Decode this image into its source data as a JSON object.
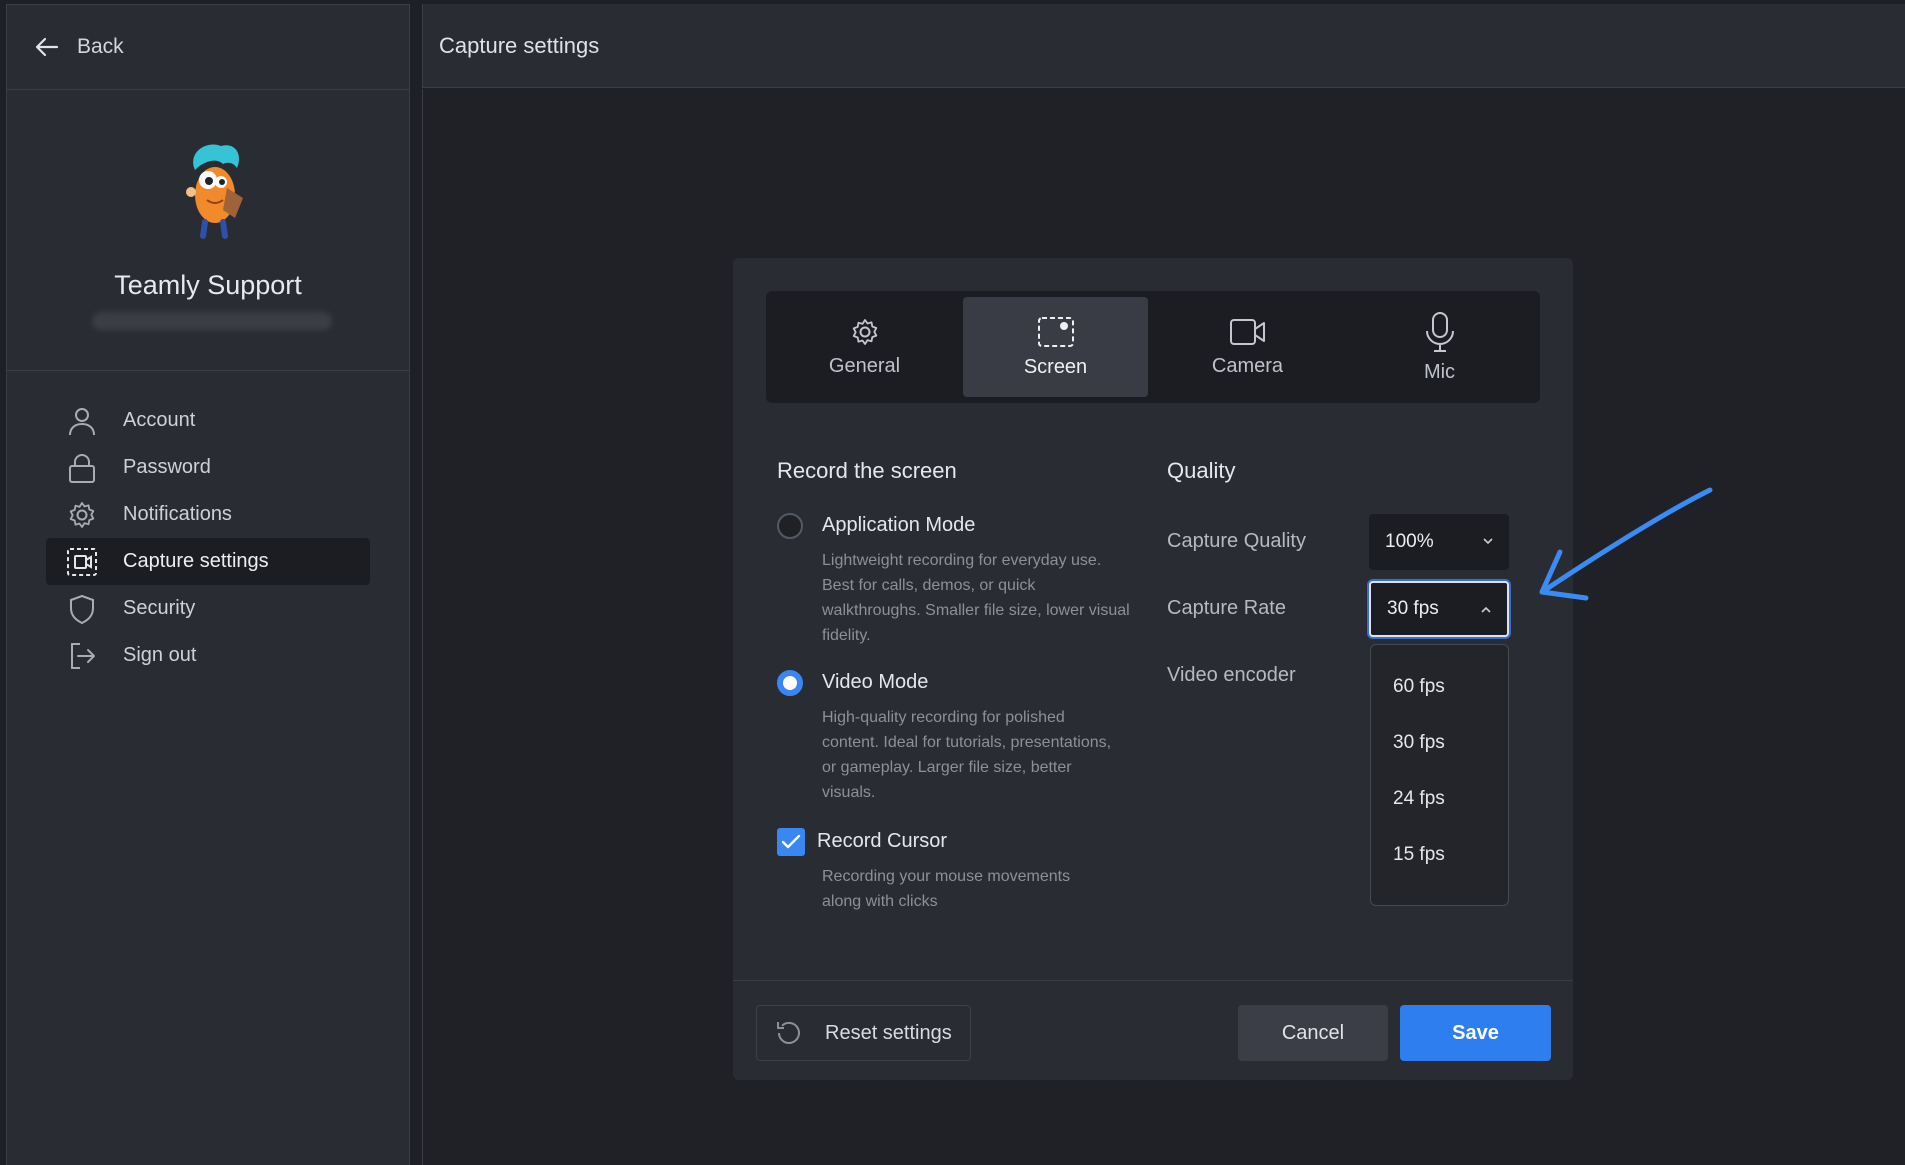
{
  "sidebar": {
    "back_label": "Back",
    "profile": {
      "name": "Teamly Support"
    },
    "items": [
      {
        "label": "Account",
        "icon": "user-icon"
      },
      {
        "label": "Password",
        "icon": "lock-icon"
      },
      {
        "label": "Notifications",
        "icon": "gear-icon"
      },
      {
        "label": "Capture settings",
        "icon": "screen-capture-icon",
        "active": true
      },
      {
        "label": "Security",
        "icon": "shield-icon"
      },
      {
        "label": "Sign out",
        "icon": "sign-out-icon"
      }
    ]
  },
  "header": {
    "title": "Capture settings"
  },
  "dialog": {
    "tabs": [
      {
        "label": "General",
        "icon": "gear-icon"
      },
      {
        "label": "Screen",
        "icon": "screen-capture-icon",
        "active": true
      },
      {
        "label": "Camera",
        "icon": "camera-icon"
      },
      {
        "label": "Mic",
        "icon": "microphone-icon"
      }
    ],
    "record": {
      "title": "Record the screen",
      "options": [
        {
          "title": "Application Mode",
          "desc": "Lightweight recording for everyday use. Best for calls, demos, or quick walkthroughs. Smaller file size, lower visual fidelity.",
          "selected": false
        },
        {
          "title": "Video Mode",
          "desc": "High-quality recording for polished content. Ideal for tutorials, presentations, or gameplay. Larger file size, better visuals.",
          "selected": true
        }
      ],
      "cursor": {
        "title": "Record Cursor",
        "desc": "Recording your mouse movements along with clicks",
        "checked": true
      }
    },
    "quality": {
      "title": "Quality",
      "capture_quality_label": "Capture Quality",
      "capture_quality_value": "100%",
      "capture_rate_label": "Capture Rate",
      "capture_rate_value": "30 fps",
      "video_encoder_label": "Video encoder",
      "rate_options": [
        "60 fps",
        "30 fps",
        "24 fps",
        "15 fps"
      ]
    },
    "footer": {
      "reset_label": "Reset settings",
      "cancel_label": "Cancel",
      "save_label": "Save"
    }
  },
  "colors": {
    "accent": "#2f7ef0",
    "annotation_arrow": "#3a8cf5",
    "background": "#1e2026",
    "panel": "#2a2c33"
  }
}
